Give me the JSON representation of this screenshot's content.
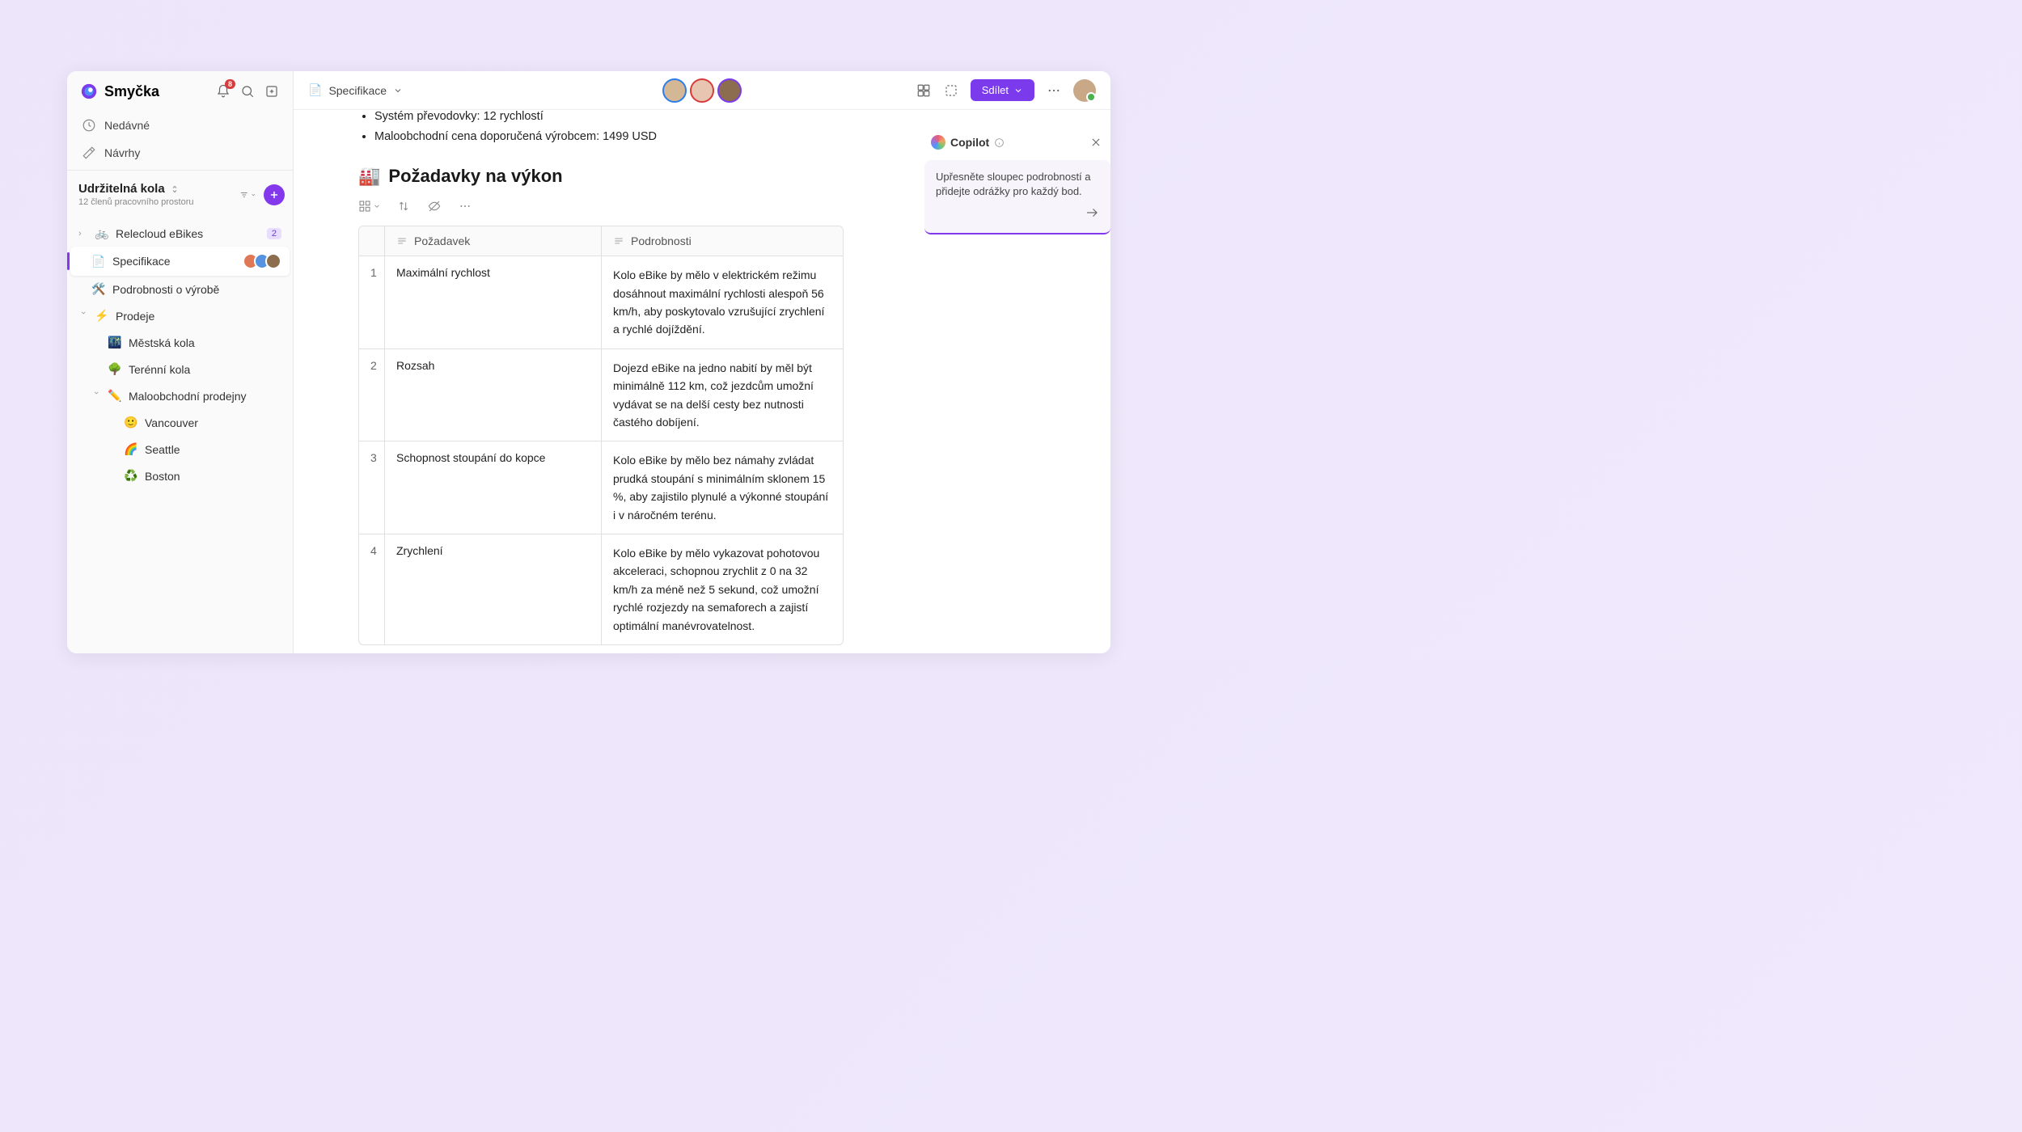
{
  "brand": "Smyčka",
  "notification_count": "8",
  "nav": {
    "recent": "Nedávné",
    "drafts": "Návrhy"
  },
  "workspace": {
    "title": "Udržitelná kola",
    "members": "12 členů pracovního prostoru"
  },
  "tree": {
    "relecloud": {
      "label": "Relecloud eBikes",
      "count": "2"
    },
    "spec": "Specifikace",
    "manufacturing": "Podrobnosti o výrobě",
    "sales": "Prodeje",
    "city": "Městská kola",
    "terrain": "Terénní kola",
    "retail": "Maloobchodní prodejny",
    "vancouver": "Vancouver",
    "seattle": "Seattle",
    "boston": "Boston"
  },
  "breadcrumb": "Specifikace",
  "share_label": "Sdílet",
  "bullets": {
    "b1": "Systém převodovky: 12 rychlostí",
    "b2": "Maloobchodní cena doporučená výrobcem: 1499 USD"
  },
  "heading": "Požadavky na výkon",
  "table": {
    "col_req": "Požadavek",
    "col_det": "Podrobnosti",
    "rows": [
      {
        "n": "1",
        "req": "Maximální rychlost",
        "det": "Kolo eBike by mělo v elektrickém režimu dosáhnout maximální rychlosti alespoň 56 km/h, aby poskytovalo vzrušující zrychlení a rychlé dojíždění."
      },
      {
        "n": "2",
        "req": "Rozsah",
        "det": "Dojezd eBike na jedno nabití by měl být minimálně 112 km, což jezdcům umožní vydávat se na delší cesty bez nutnosti častého dobíjení."
      },
      {
        "n": "3",
        "req": "Schopnost stoupání do kopce",
        "det": "Kolo eBike by mělo bez námahy zvládat prudká stoupání s minimálním sklonem 15 %, aby zajistilo plynulé a výkonné stoupání i v náročném terénu."
      },
      {
        "n": "4",
        "req": "Zrychlení",
        "det": "Kolo eBike by mělo vykazovat pohotovou akceleraci, schopnou zrychlit z 0 na 32 km/h za méně než 5 sekund, což umožní rychlé rozjezdy na semaforech a zajistí optimální manévrovatelnost."
      }
    ]
  },
  "copilot": {
    "title": "Copilot",
    "prompt": "Upřesněte sloupec podrobností a přidejte odrážky pro každý bod."
  }
}
